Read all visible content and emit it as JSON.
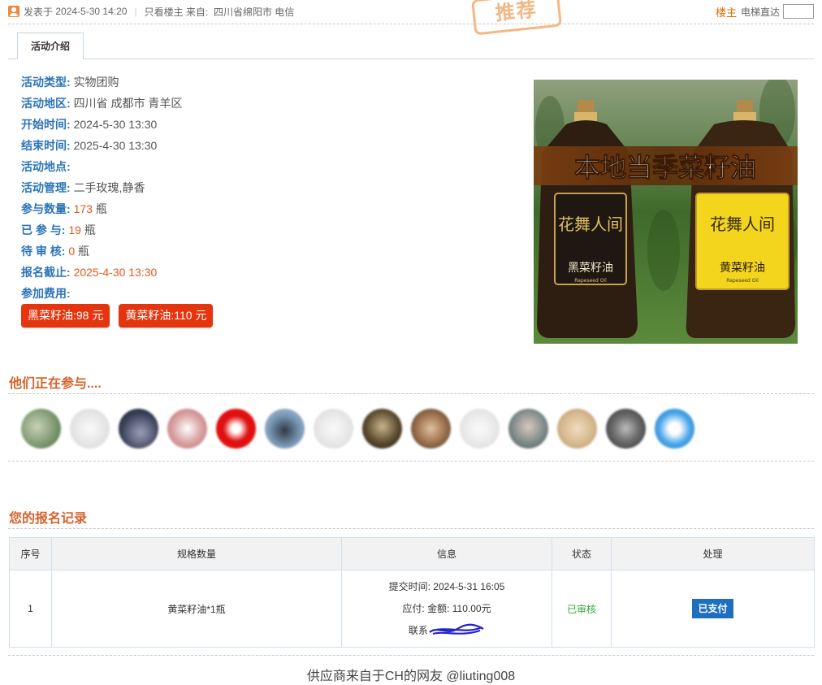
{
  "post": {
    "posted_label": "发表于",
    "posted_time": "2024-5-30 14:20",
    "only_owner": "只看楼主",
    "from_label": "来自:",
    "location": "四川省绵阳市 电信",
    "floor_owner": "楼主",
    "jump_label": "电梯直达",
    "stamp": "推荐"
  },
  "tab": {
    "label": "活动介绍"
  },
  "activity": {
    "type_label": "活动类型:",
    "type_value": "实物团购",
    "region_label": "活动地区:",
    "region_value": "四川省 成都市 青羊区",
    "start_label": "开始时间:",
    "start_value": "2024-5-30 13:30",
    "end_label": "结束时间:",
    "end_value": "2025-4-30 13:30",
    "place_label": "活动地点:",
    "manager_label": "活动管理:",
    "manager_value": "二手玫瑰,静香",
    "quantity_label": "参与数量:",
    "quantity_value": "173",
    "quantity_unit": "瓶",
    "joined_label": "已 参 与:",
    "joined_value": "19",
    "joined_unit": "瓶",
    "pending_label": "待 审 核:",
    "pending_value": "0",
    "pending_unit": "瓶",
    "deadline_label": "报名截止:",
    "deadline_value": "2025-4-30 13:30",
    "fee_label": "参加费用:",
    "fees": [
      "黑菜籽油:98 元",
      "黄菜籽油:110 元"
    ]
  },
  "product_image": {
    "banner": "本地当季菜籽油",
    "brand": "花舞人间",
    "left_bottle": "黑菜籽油",
    "right_bottle": "黄菜籽油",
    "sub": "Rapeseed Oil",
    "colors": {
      "field": "#3e6b2a",
      "banner": "#6b3a12",
      "yellow": "#f2d51c",
      "dark": "#2c1f14"
    }
  },
  "participants": {
    "heading": "他们正在参与....",
    "avatar_colors": [
      "#6d8a5e",
      "#e4e4e4",
      "#3a3f58",
      "#d9a4a4",
      "#e01010",
      "#7d9cba",
      "#e2e2e2",
      "#5a4a2e",
      "#a67b56",
      "#e6e6e6",
      "#7f8a88",
      "#d6b88e",
      "#6e6e6e",
      "#4aa6e8"
    ]
  },
  "records": {
    "heading": "您的报名记录",
    "columns": [
      "序号",
      "规格数量",
      "信息",
      "状态",
      "处理"
    ],
    "rows": [
      {
        "index": "1",
        "spec": "黄菜籽油*1瓶",
        "submit_time": "提交时间: 2024-5-31 16:05",
        "amount": "应付: 金额: 110.00元",
        "contact": "联系",
        "status": "已审核",
        "action": "已支付"
      }
    ]
  },
  "footer": {
    "text": "供应商来自于CH的网友 @liuting008"
  }
}
